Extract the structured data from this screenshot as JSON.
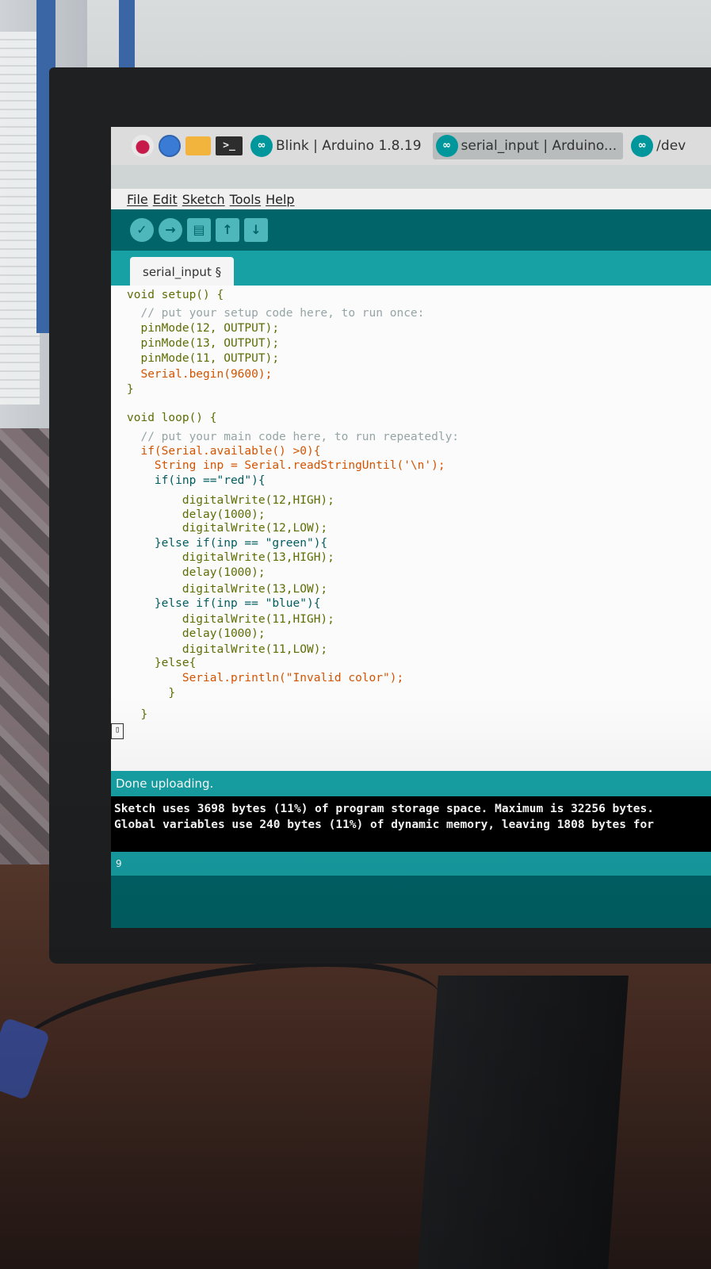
{
  "taskbar": {
    "tasks": [
      {
        "label": "Blink | Arduino 1.8.19"
      },
      {
        "label": "serial_input | Arduino..."
      },
      {
        "label": "/dev"
      }
    ],
    "terminal_glyph": ">_",
    "arduino_glyph": "∞"
  },
  "menu": {
    "file": "File",
    "edit": "Edit",
    "sketch": "Sketch",
    "tools": "Tools",
    "help": "Help"
  },
  "toolbar": {
    "verify": "✓",
    "upload": "→",
    "new": "▤",
    "open": "↑",
    "save": "↓"
  },
  "tab": {
    "label": "serial_input §"
  },
  "code": [
    "void setup() {",
    "  // put your setup code here, to run once:",
    "  pinMode(12, OUTPUT);",
    "  pinMode(13, OUTPUT);",
    "  pinMode(11, OUTPUT);",
    "  Serial.begin(9600);",
    "}",
    "",
    "void loop() {",
    "  // put your main code here, to run repeatedly:",
    "  if(Serial.available() >0){",
    "    String inp = Serial.readStringUntil('\\n');",
    "    if(inp ==\"red\"){",
    "        digitalWrite(12,HIGH);",
    "        delay(1000);",
    "        digitalWrite(12,LOW);",
    "    }else if(inp == \"green\"){",
    "        digitalWrite(13,HIGH);",
    "        delay(1000);",
    "        digitalWrite(13,LOW);",
    "    }else if(inp == \"blue\"){",
    "        digitalWrite(11,HIGH);",
    "        delay(1000);",
    "        digitalWrite(11,LOW);",
    "    }else{",
    "        Serial.println(\"Invalid color\");",
    "      }",
    "",
    "  }"
  ],
  "status": {
    "message": "Done uploading."
  },
  "console": {
    "line1": "Sketch uses 3698 bytes (11%) of program storage space. Maximum is 32256 bytes.",
    "line2": "Global variables use 240 bytes (11%) of dynamic memory, leaving 1808 bytes for"
  },
  "footer": {
    "line_number": "9"
  },
  "colors": {
    "arduino_dark": "#006468",
    "arduino_teal": "#17a1a5",
    "arduino_light": "#4db7bb",
    "keyword": "#5e6d03",
    "serial": "#d35400",
    "comment": "#95a5a6",
    "string": "#005c5f"
  }
}
